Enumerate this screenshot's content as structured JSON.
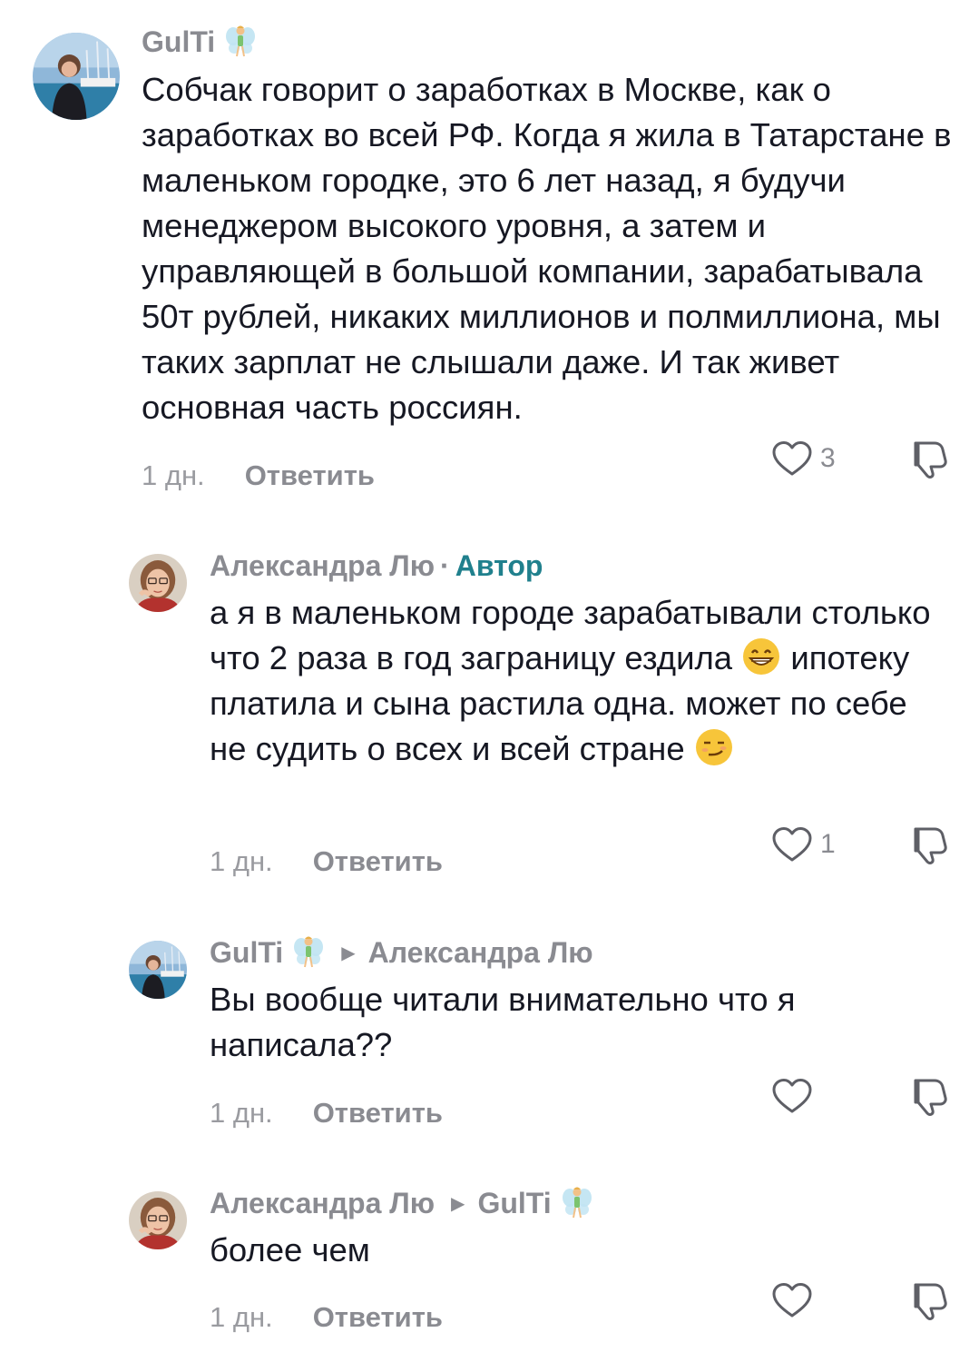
{
  "comments": [
    {
      "username": "GulTi",
      "text": "Собчак говорит о заработках в Москве, как о заработках во всей РФ. Когда я жила в Татарстане в маленьком городке, это 6 лет назад, я будучи менеджером высокого уровня, а затем и управляющей в большой компании, зарабатывала 50т рублей, никаких миллионов и полмиллиона, мы таких зарплат не слышали даже. И так живет основная часть россиян.",
      "time": "1 дн.",
      "reply_label": "Ответить",
      "likes": "3"
    },
    {
      "username": "Александра Лю",
      "separator": "·",
      "author_tag": "Автор",
      "text_part1": "а я в маленьком городе зарабатывали столько что 2 раза в год заграницу ездила",
      "text_part2": " ипотеку платила и сына растила одна. может по себе не судить о всех и всей стране",
      "time": "1 дн.",
      "reply_label": "Ответить",
      "likes": "1"
    },
    {
      "username": "GulTi",
      "reply_to": "Александра Лю",
      "text": "Вы вообще читали внимательно что я написала??",
      "time": "1 дн.",
      "reply_label": "Ответить"
    },
    {
      "username": "Александра Лю",
      "reply_to": "GulTi",
      "text": "более чем",
      "time": "1 дн.",
      "reply_label": "Ответить"
    }
  ],
  "icons": {
    "like": "heart-outline-icon",
    "dislike": "thumbs-down-icon",
    "badge": "fairy-emoji",
    "reply_arrow": "triangle-right-icon"
  },
  "colors": {
    "text": "#161823",
    "secondary": "#8a8b91",
    "author_tag": "#20808d"
  }
}
